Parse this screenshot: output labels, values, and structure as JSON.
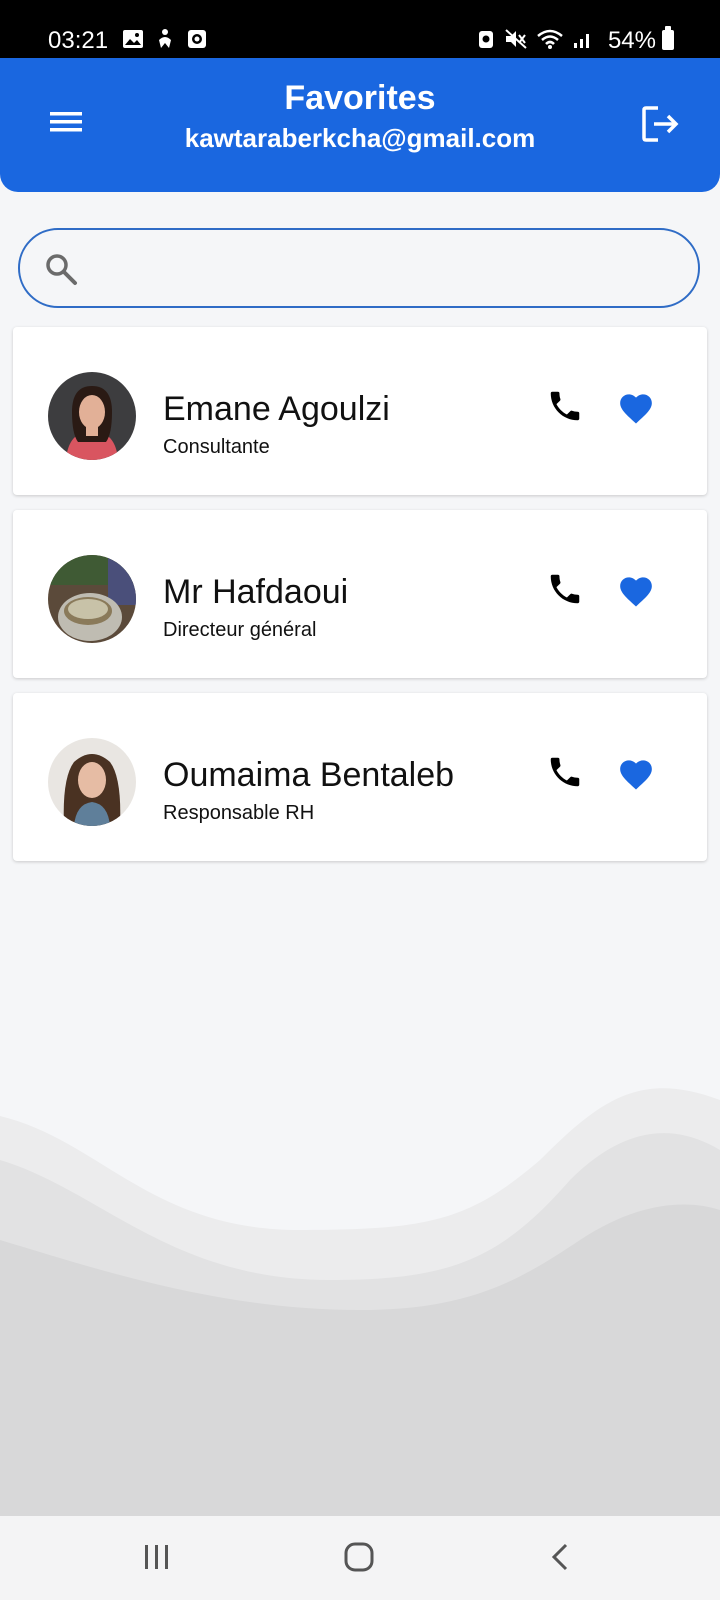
{
  "status_bar": {
    "time": "03:21",
    "battery": "54%",
    "left_icons": [
      "gallery-icon",
      "accessibility-icon",
      "screen-record-icon"
    ],
    "right_icons": [
      "alarm-icon",
      "mute-icon",
      "wifi-icon",
      "signal-icon",
      "battery-icon"
    ]
  },
  "header": {
    "title": "Favorites",
    "subtitle": "kawtaraberkcha@gmail.com",
    "menu_icon": "hamburger-menu-icon",
    "logout_icon": "logout-icon",
    "color": "#1a67e0"
  },
  "search": {
    "placeholder": "",
    "value": "",
    "icon": "search-icon"
  },
  "contacts": [
    {
      "name": "Emane Agoulzi",
      "role": "Consultante",
      "favorite": true
    },
    {
      "name": "Mr Hafdaoui",
      "role": "Directeur général",
      "favorite": true
    },
    {
      "name": "Oumaima Bentaleb",
      "role": "Responsable RH",
      "favorite": true
    }
  ],
  "colors": {
    "accent": "#1a67e0",
    "heart": "#1a67e0",
    "background": "#f5f6f8"
  },
  "nav_bar": {
    "icons": [
      "recent-apps-icon",
      "home-icon",
      "back-icon"
    ]
  }
}
